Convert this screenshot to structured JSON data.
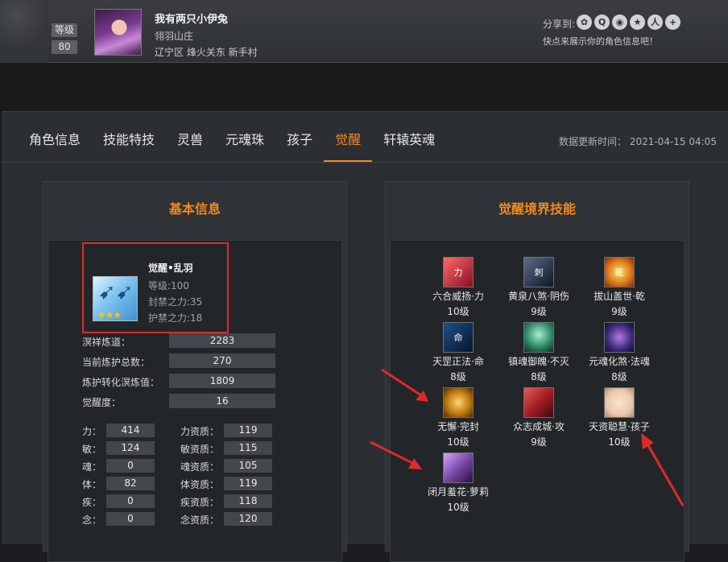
{
  "profile": {
    "level_label": "等级",
    "level_value": "80",
    "name": "我有两只小伊兔",
    "guild": "翎羽山庄",
    "server": "辽宁区 烽火关东 新手村",
    "share_label": "分享到:",
    "share_hint": "快点来展示你的角色信息吧！",
    "share_icons": [
      "wechat-icon",
      "qq-icon",
      "weibo-icon",
      "qzone-icon",
      "renren-icon",
      "plus-icon"
    ]
  },
  "tabs": [
    "角色信息",
    "技能特技",
    "灵兽",
    "元魂珠",
    "孩子",
    "觉醒",
    "轩辕英魂"
  ],
  "active_tab": "觉醒",
  "update_time": "数据更新时间： 2021-04-15 04:05",
  "basic": {
    "title": "基本信息",
    "awaken_name": "觉醒•乱羽",
    "awaken_level": "等级:100",
    "seal_power": "封禁之力:35",
    "guard_power": "护禁之力:18",
    "stats": [
      {
        "label": "溟祥炼道：",
        "value": "2283"
      },
      {
        "label": "当前炼护总数：",
        "value": "270"
      },
      {
        "label": "炼护转化溟炼值：",
        "value": "1809"
      },
      {
        "label": "觉醒度：",
        "value": "16"
      }
    ],
    "attrs": [
      {
        "label": "力：",
        "value": "414",
        "apt_label": "力资质：",
        "apt_value": "119"
      },
      {
        "label": "敏：",
        "value": "124",
        "apt_label": "敏资质：",
        "apt_value": "115"
      },
      {
        "label": "魂：",
        "value": "0",
        "apt_label": "魂资质：",
        "apt_value": "105"
      },
      {
        "label": "体：",
        "value": "82",
        "apt_label": "体资质：",
        "apt_value": "119"
      },
      {
        "label": "疾：",
        "value": "0",
        "apt_label": "疾资质：",
        "apt_value": "118"
      },
      {
        "label": "念：",
        "value": "0",
        "apt_label": "念资质：",
        "apt_value": "120"
      }
    ]
  },
  "skills": {
    "title": "觉醒境界技能",
    "items": [
      {
        "name": "六合威扬·力",
        "level": "10级",
        "glyph": "力",
        "color": "#b3243a"
      },
      {
        "name": "黄泉八煞·阴伤",
        "level": "9级",
        "glyph": "刺",
        "color": "#1e2a44"
      },
      {
        "name": "拔山盖世·乾",
        "level": "9级",
        "glyph": "乾",
        "color": "#d9731a"
      },
      {
        "name": "天罡正法·命",
        "level": "8级",
        "glyph": "命",
        "color": "#102a52"
      },
      {
        "name": "镇魂御魄·不灭",
        "level": "8级",
        "glyph": "",
        "color": "#2f8a6a"
      },
      {
        "name": "元魂化煞·法魂",
        "level": "8级",
        "glyph": "",
        "color": "#3a2a7a"
      },
      {
        "name": "无懈·完封",
        "level": "10级",
        "glyph": "",
        "color": "#c07a12"
      },
      {
        "name": "众志成城·攻",
        "level": "9级",
        "glyph": "",
        "color": "#a61e26"
      },
      {
        "name": "天资聪慧·孩子",
        "level": "10级",
        "glyph": "",
        "color": "#e9c9b0"
      },
      {
        "name": "闭月羞花·萝莉",
        "level": "10级",
        "glyph": "",
        "color": "#7a4aa8"
      }
    ]
  }
}
